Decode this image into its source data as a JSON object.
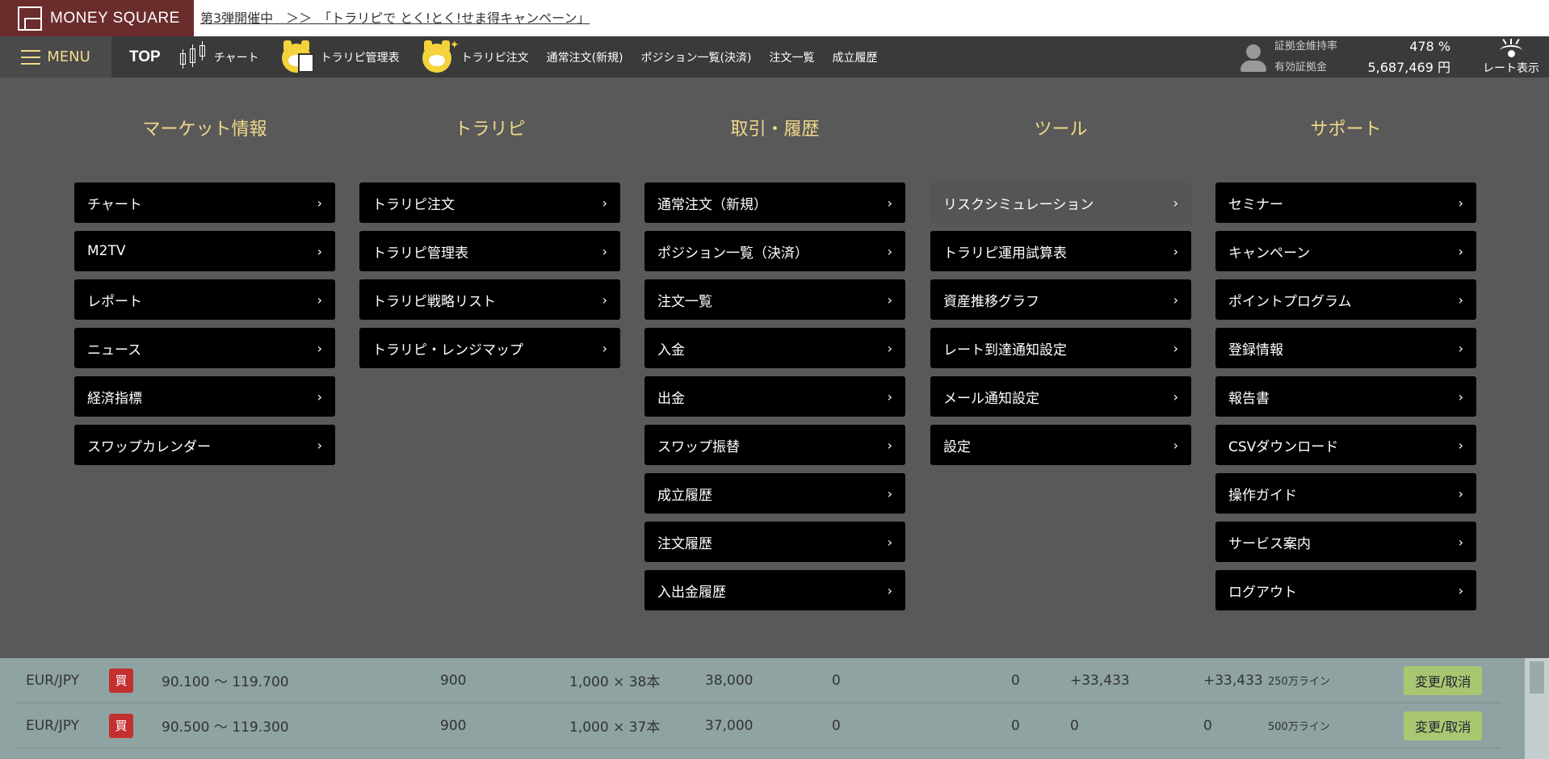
{
  "banner": {
    "logo_text": "MONEY SQUARE",
    "campaign_text": "第3弾開催中　＞＞　「トラリピで とく!とく!せま得キャンペーン」"
  },
  "nav": {
    "menu_label": "MENU",
    "top_label": "TOP",
    "chart_label": "チャート",
    "trapi_manage_label": "トラリピ管理表",
    "trapi_order_label": "トラリピ注文",
    "normal_order_label": "通常注文(新規)",
    "positions_label": "ポジション一覧(決済)",
    "orders_label": "注文一覧",
    "history_label": "成立履歴",
    "margin_ratio_label": "証拠金維持率",
    "margin_ratio_value": "478 %",
    "effective_margin_label": "有効証拠金",
    "effective_margin_value": "5,687,469 円",
    "rate_display_label": "レート表示"
  },
  "menu": {
    "columns": [
      {
        "title": "マーケット情報",
        "items": [
          "チャート",
          "M2TV",
          "レポート",
          "ニュース",
          "経済指標",
          "スワップカレンダー"
        ]
      },
      {
        "title": "トラリピ",
        "items": [
          "トラリピ注文",
          "トラリピ管理表",
          "トラリピ戦略リスト",
          "トラリピ・レンジマップ"
        ]
      },
      {
        "title": "取引・履歴",
        "items": [
          "通常注文（新規）",
          "ポジション一覧（決済）",
          "注文一覧",
          "入金",
          "出金",
          "スワップ振替",
          "成立履歴",
          "注文履歴",
          "入出金履歴"
        ]
      },
      {
        "title": "ツール",
        "items": [
          "リスクシミュレーション",
          "トラリピ運用試算表",
          "資産推移グラフ",
          "レート到達通知設定",
          "メール通知設定",
          "設定"
        ]
      },
      {
        "title": "サポート",
        "items": [
          "セミナー",
          "キャンペーン",
          "ポイントプログラム",
          "登録情報",
          "報告書",
          "CSVダウンロード",
          "操作ガイド",
          "サービス案内",
          "ログアウト"
        ]
      }
    ],
    "chevron": "›"
  },
  "table": {
    "rows": [
      {
        "pair": "EUR/JPY",
        "side": "買",
        "range": "90.100 ～ 119.700",
        "traps": "900",
        "qty": "1,000 × 38本",
        "total": "38,000",
        "c1": "0",
        "c2": "0",
        "pl1": "+33,433",
        "pl2": "+33,433",
        "line": "250万ライン",
        "action": "変更/取消"
      },
      {
        "pair": "EUR/JPY",
        "side": "買",
        "range": "90.500 ～ 119.300",
        "traps": "900",
        "qty": "1,000 × 37本",
        "total": "37,000",
        "c1": "0",
        "c2": "0",
        "pl1": "0",
        "pl2": "0",
        "line": "500万ライン",
        "action": "変更/取消"
      }
    ]
  }
}
